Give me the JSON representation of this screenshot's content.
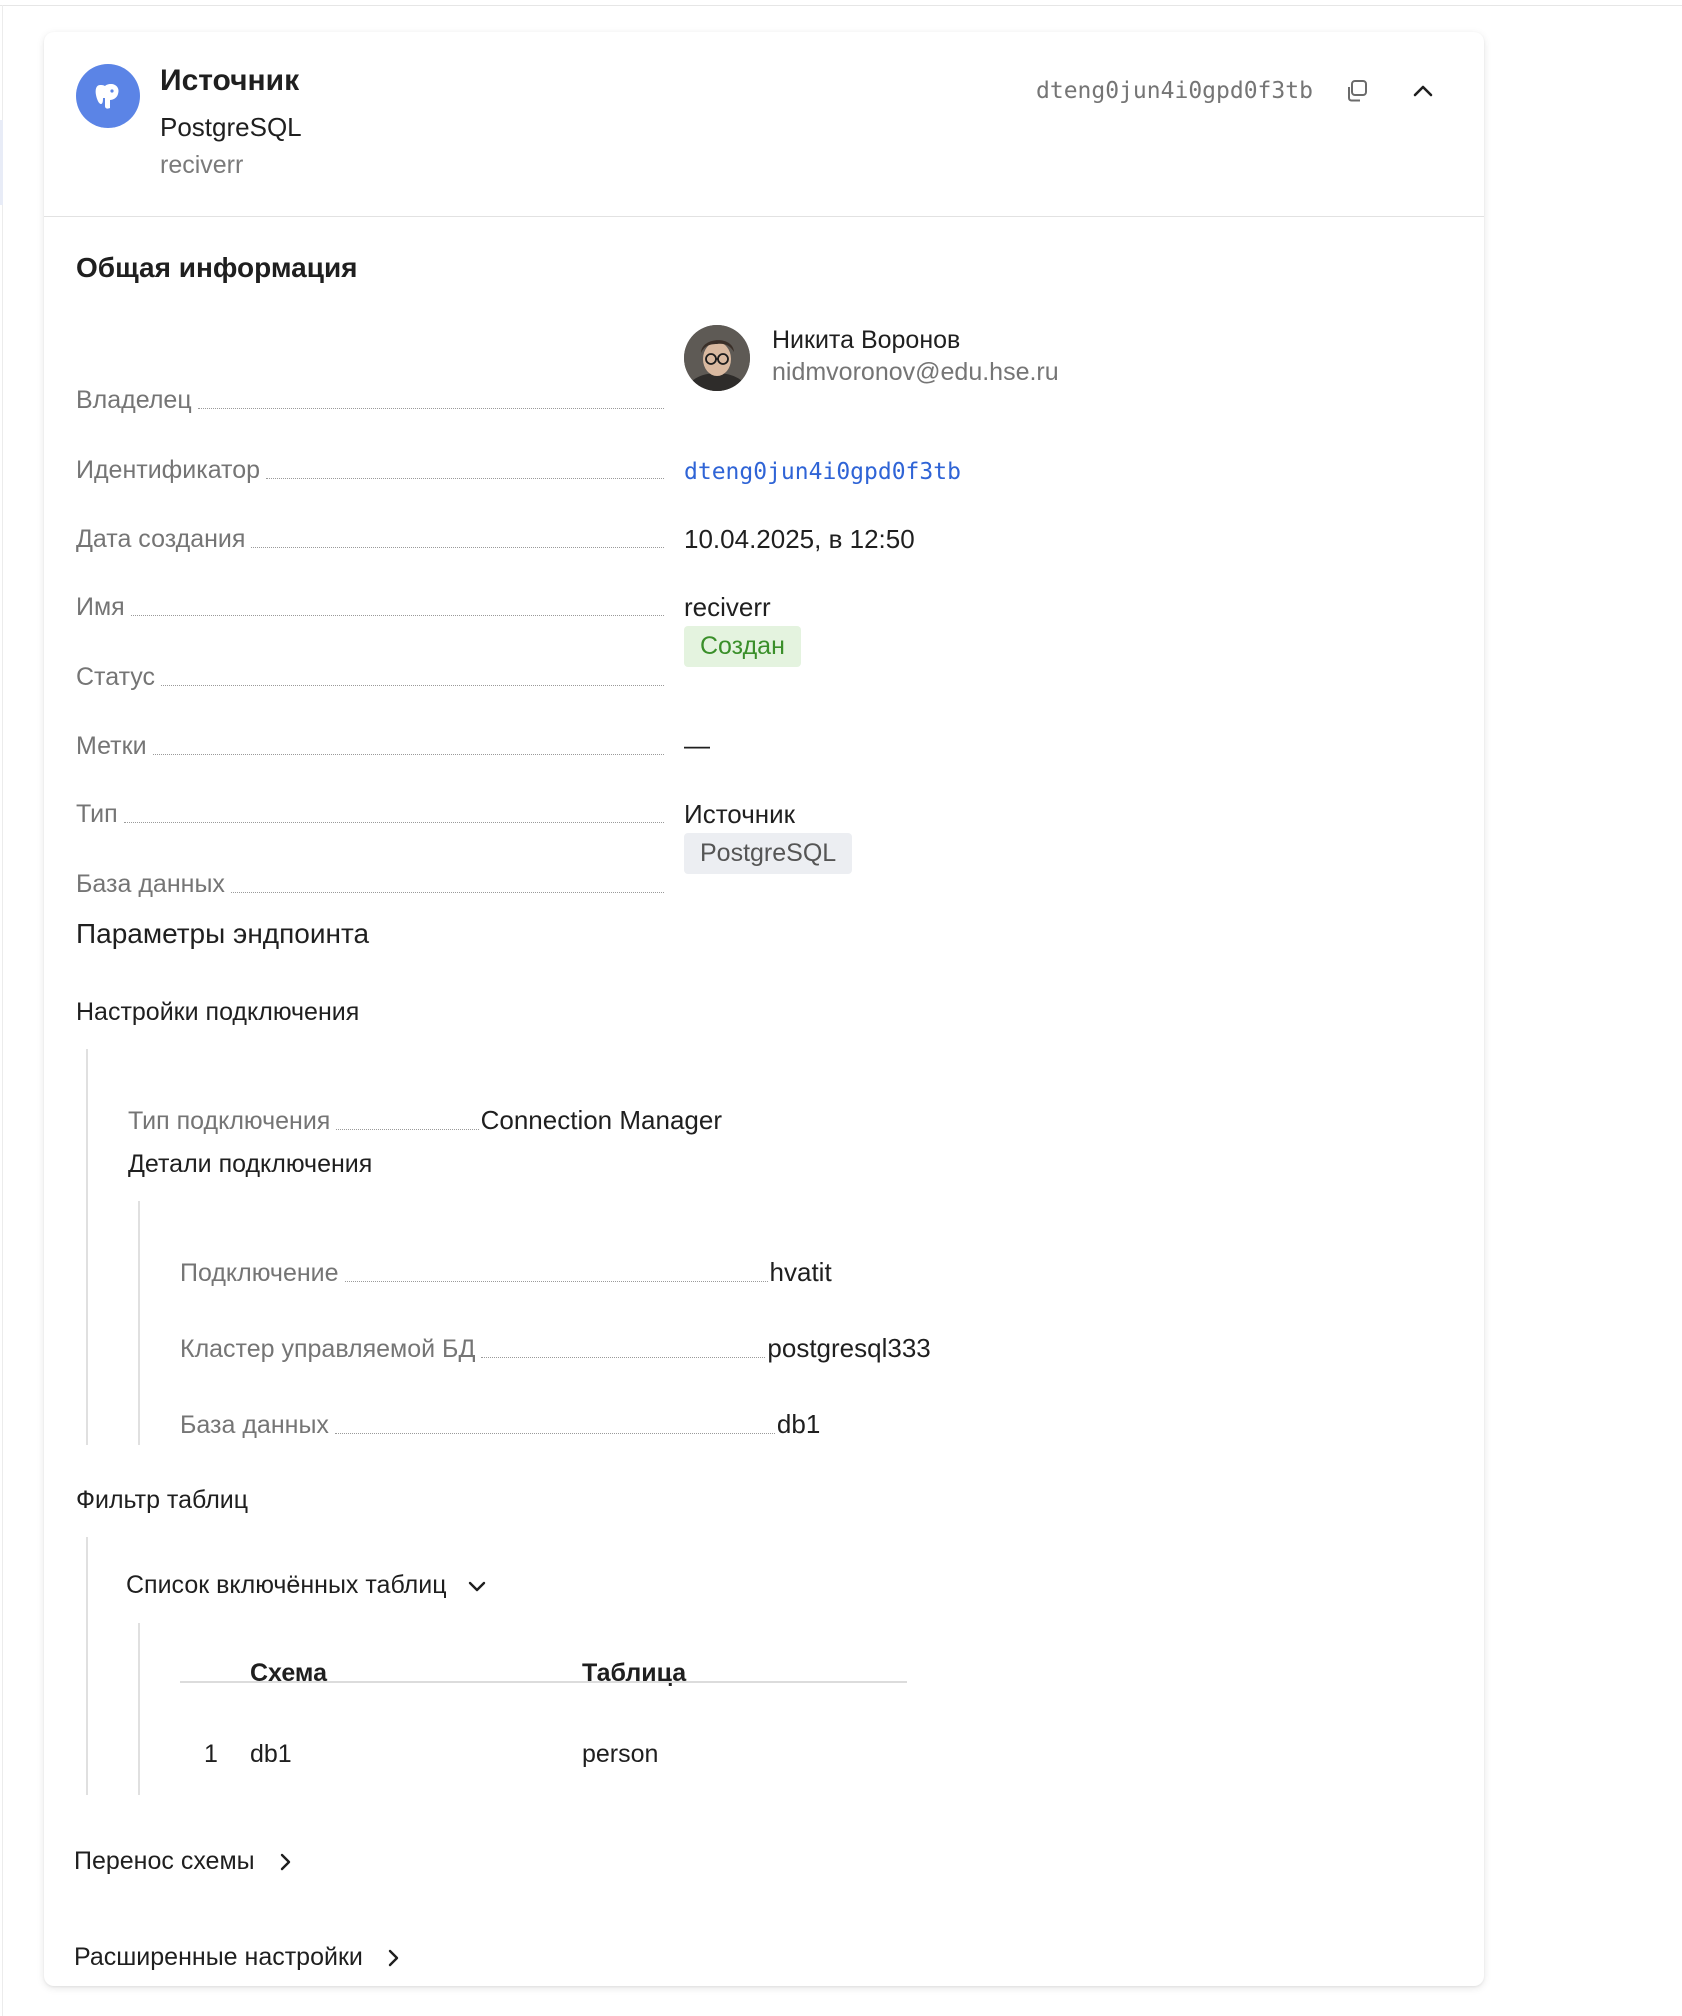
{
  "header": {
    "kind": "Источник",
    "db_type": "PostgreSQL",
    "name": "reciverr",
    "id": "dteng0jun4i0gpd0f3tb",
    "icons": {
      "logo": "postgresql-elephant-icon",
      "copy": "copy-icon",
      "collapse": "chevron-up-icon"
    }
  },
  "general": {
    "title": "Общая информация",
    "owner": {
      "label": "Владелец",
      "name": "Никита Воронов",
      "email": "nidmvoronov@edu.hse.ru"
    },
    "identifier": {
      "label": "Идентификатор",
      "value": "dteng0jun4i0gpd0f3tb"
    },
    "created": {
      "label": "Дата создания",
      "value": "10.04.2025, в 12:50"
    },
    "name": {
      "label": "Имя",
      "value": "reciverr"
    },
    "status": {
      "label": "Статус",
      "value": "Создан"
    },
    "labels": {
      "label": "Метки",
      "value": "—"
    },
    "type": {
      "label": "Тип",
      "value": "Источник"
    },
    "database": {
      "label": "База данных",
      "value": "PostgreSQL"
    }
  },
  "endpoint": {
    "title": "Параметры эндпоинта",
    "connection_settings": {
      "title": "Настройки подключения",
      "conn_type": {
        "label": "Тип подключения",
        "value": "Connection Manager"
      },
      "details": {
        "title": "Детали подключения",
        "connection": {
          "label": "Подключение",
          "value": "hvatit"
        },
        "cluster": {
          "label": "Кластер управляемой БД",
          "value": "postgresql333"
        },
        "database": {
          "label": "База данных",
          "value": "db1"
        }
      }
    },
    "table_filter": {
      "title": "Фильтр таблиц",
      "included_toggle": "Список включённых таблиц",
      "columns": [
        "Схема",
        "Таблица"
      ],
      "rows": [
        {
          "n": "1",
          "schema": "db1",
          "table": "person"
        }
      ]
    },
    "schema_transfer": "Перенос схемы",
    "advanced": "Расширенные настройки"
  },
  "colors": {
    "accent": "#2f64d6",
    "status_ok_bg": "#e4f3df",
    "status_ok_fg": "#3a8f2a",
    "logo_bg": "#5b84e6"
  }
}
